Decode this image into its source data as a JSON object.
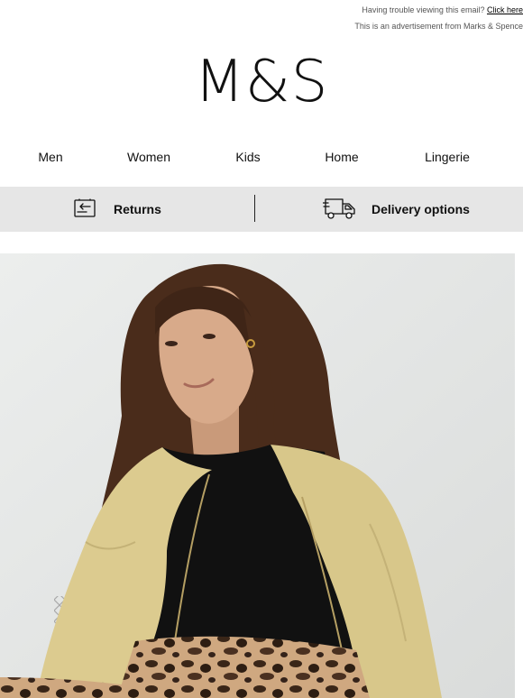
{
  "preheader": {
    "trouble_text": "Having trouble viewing this email?",
    "click_here": "Click here",
    "ad_notice": "This is an advertisement from Marks & Spence"
  },
  "brand": {
    "logo": "M&S"
  },
  "nav": [
    "Men",
    "Women",
    "Kids",
    "Home",
    "Lingerie"
  ],
  "service_bar": {
    "returns_label": "Returns",
    "returns_icon": "returns-icon",
    "delivery_label": "Delivery options",
    "delivery_icon": "delivery-truck-icon"
  },
  "hero": {
    "image": "model-in-yellow-jacket-photo"
  },
  "colors": {
    "service_bar_bg": "#e6e6e6",
    "text": "#111111",
    "jacket": "#dccb8f"
  }
}
